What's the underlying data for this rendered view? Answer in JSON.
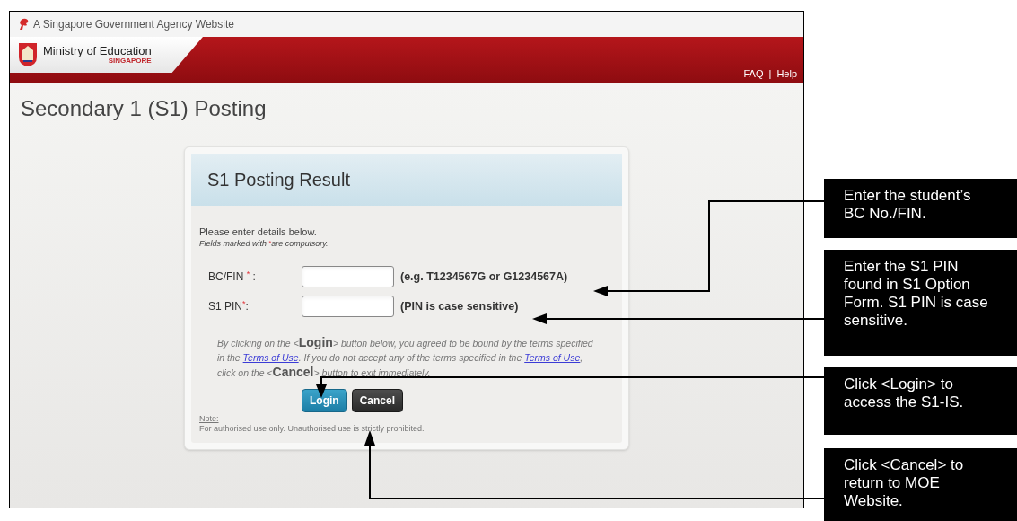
{
  "agency_bar": {
    "text": "A Singapore Government Agency Website"
  },
  "header": {
    "ministry": "Ministry of Education",
    "country": "SINGAPORE",
    "links": [
      "FAQ",
      "Help"
    ],
    "separator": "|"
  },
  "page_title": "Secondary 1 (S1) Posting",
  "form": {
    "title": "S1 Posting Result",
    "instruction": "Please enter details below.",
    "compulsory_note": {
      "before": "Fields marked with ",
      "mark": "*",
      "after": "are compulsory."
    },
    "fields": [
      {
        "label": "BC/FIN ",
        "mark": "*",
        "colon": " :",
        "hint": "(e.g. T1234567G or G1234567A)"
      },
      {
        "label": "S1 PIN",
        "mark": "*",
        "colon": ":",
        "hint": "(PIN is case sensitive)"
      }
    ],
    "terms": [
      {
        "kind": "text",
        "text": "By clicking on the <"
      },
      {
        "kind": "strong",
        "text": "Login"
      },
      {
        "kind": "text",
        "text": "> button below, you agreed to be bound by the terms specified in the "
      },
      {
        "kind": "link",
        "text": "Terms of Use"
      },
      {
        "kind": "text",
        "text": ". If you do not accept any of the terms specified in the "
      },
      {
        "kind": "link",
        "text": "Terms of Use"
      },
      {
        "kind": "text",
        "text": ", click on the <"
      },
      {
        "kind": "strong",
        "text": "Cancel"
      },
      {
        "kind": "text",
        "text": "> button to exit immediately."
      }
    ],
    "buttons": [
      {
        "label": "Login",
        "kind": "primary"
      },
      {
        "label": "Cancel",
        "kind": "secondary"
      }
    ],
    "note_label": "Note:",
    "note": "For authorised use only. Unauthorised use is strictly prohibited."
  },
  "callouts": [
    "Enter the student’s BC No./FIN.",
    "Enter the S1 PIN found in S1 Option Form. S1 PIN is case sensitive.",
    "Click <Login> to access the S1-IS.",
    "Click <Cancel> to return to MOE Website."
  ]
}
